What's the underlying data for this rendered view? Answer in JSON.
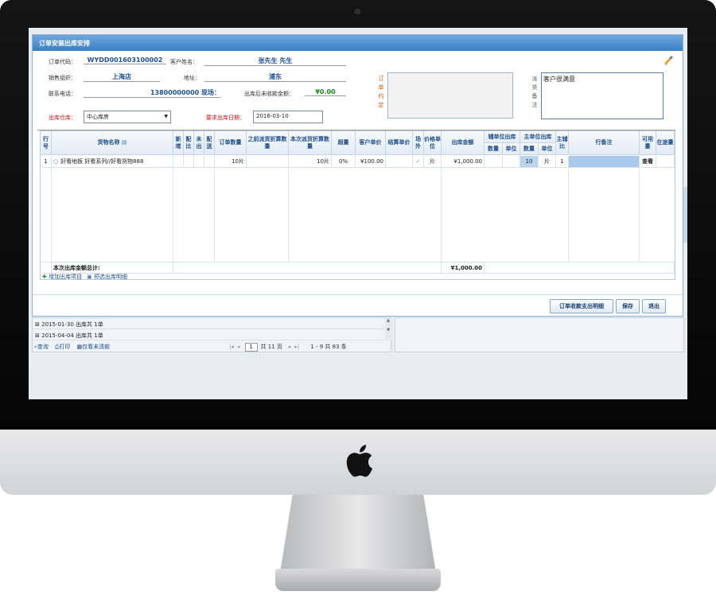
{
  "dialog": {
    "title": "订单安装出库安排",
    "order_code_label": "订单代码：",
    "order_code": "WYDD001603100002",
    "customer_label": "客户姓名：",
    "customer_name": "张先生 先生",
    "sales_org_label": "销售组织：",
    "sales_org": "上海店",
    "address_label": "地址：",
    "address": "浦东",
    "phone_label": "联系电话：",
    "phone": "13800000000 现场：",
    "uncollected_label": "出库后未收款金额：",
    "uncollected_amount": "¥0.00",
    "order_agreement_label": "订单约定",
    "dispatch_note_label": "派货备注",
    "dispatch_note": "客户很满意",
    "warehouse_label": "出库仓库：",
    "warehouse_value": "中心库房",
    "date_label": "要求出库日期：",
    "date_value": "2016-03-10"
  },
  "grid": {
    "headers": {
      "row_no": "行号",
      "goods_name": "货物名称",
      "new_add": "新增",
      "config": "配比",
      "not_out": "未出",
      "deliver": "配送",
      "order_qty": "订单数量",
      "prev_dispatch": "之前派货折算数量",
      "this_dispatch": "本次派货折算数量",
      "over_qty": "超量",
      "cust_price": "客户单价",
      "settle_price": "结算单价",
      "outside": "场外",
      "price_unit": "价格单位",
      "out_amount": "出库金额",
      "aux_group": "辅单位出库",
      "aux_qty": "数量",
      "aux_unit": "单位",
      "main_group": "主单位出库",
      "main_qty": "数量",
      "main_unit": "单位",
      "main_aux_ratio": "主辅比",
      "line_note": "行备注",
      "available": "可用量",
      "in_transit": "在途量"
    },
    "row": {
      "no": "1",
      "goods": "好看地板 好看系列//好看货物888",
      "order_qty": "10片",
      "this_dispatch": "10片",
      "over": "0%",
      "cust_price": "¥100.00",
      "price_unit": "片",
      "out_amount": "¥1,000.00",
      "main_qty": "10",
      "main_unit": "片",
      "ratio": "1",
      "available": "查看"
    },
    "total_label": "本次出库金额总计:",
    "total_amount": "¥1,000.00",
    "add_item": "增加出库项目",
    "preview": "预选出库明细"
  },
  "buttons": {
    "detail": "订单收款支出明细",
    "save": "保存",
    "exit": "退出"
  },
  "list": {
    "group1": "2015-01-30 出库共 1单",
    "group2": "2015-04-04 出库共 1单",
    "query": "查询",
    "print": "打印",
    "only_unpaid": "仅看未清款",
    "page_input": "1",
    "page_total": "共 11 页",
    "range": "1 - 9 共 83 条"
  },
  "colors": {
    "title_bar": "#3a7fc6",
    "header_text": "#1f4e8c",
    "value_blue": "#1d4f9c",
    "required_red": "#d01010",
    "money_green": "#1b8a1b"
  }
}
